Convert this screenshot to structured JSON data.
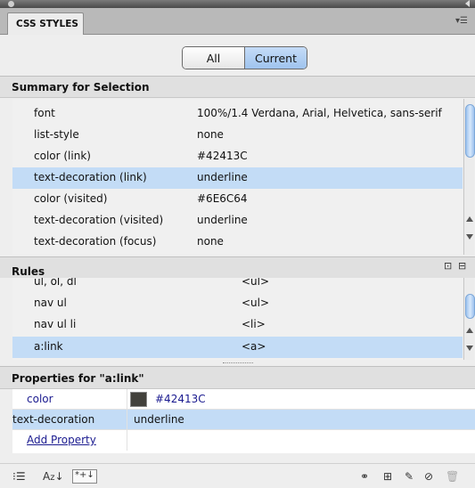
{
  "panel": {
    "tab_label": "CSS STYLES",
    "menu_glyph": "▾☰"
  },
  "view_toggle": {
    "all_label": "All",
    "current_label": "Current",
    "selected": "Current"
  },
  "summary": {
    "title": "Summary for Selection",
    "rows": [
      {
        "property": "font",
        "value": "100%/1.4 Verdana, Arial, Helvetica, sans-serif"
      },
      {
        "property": "list-style",
        "value": "none"
      },
      {
        "property": "color (link)",
        "value": "#42413C"
      },
      {
        "property": "text-decoration (link)",
        "value": "underline",
        "selected": true
      },
      {
        "property": "color (visited)",
        "value": "#6E6C64"
      },
      {
        "property": "text-decoration (visited)",
        "value": "underline"
      },
      {
        "property": "text-decoration (focus)",
        "value": "none"
      }
    ]
  },
  "rules": {
    "title": "Rules",
    "rows": [
      {
        "selector": "ul, ol, dl",
        "tag": "<ul>"
      },
      {
        "selector": "nav ul",
        "tag": "<ul>"
      },
      {
        "selector": "nav ul li",
        "tag": "<li>"
      },
      {
        "selector": "a:link",
        "tag": "<a>",
        "selected": true
      }
    ]
  },
  "properties": {
    "title": "Properties for \"a:link\"",
    "rows": [
      {
        "name": "color",
        "value": "#42413C",
        "swatch": "#42413C"
      },
      {
        "name": "text-decoration",
        "value": "underline",
        "selected": true
      }
    ],
    "add_property_label": "Add Property"
  },
  "footer": {
    "left_icons": [
      "category-view-icon",
      "alpha-sort-icon",
      "set-properties-only-icon"
    ],
    "right_icons": [
      "attach-stylesheet-icon",
      "new-rule-icon",
      "edit-rule-icon",
      "disable-property-icon",
      "delete-rule-icon"
    ]
  },
  "colors": {
    "selection": "#c3dcf6",
    "swatch_color": "#42413C"
  }
}
